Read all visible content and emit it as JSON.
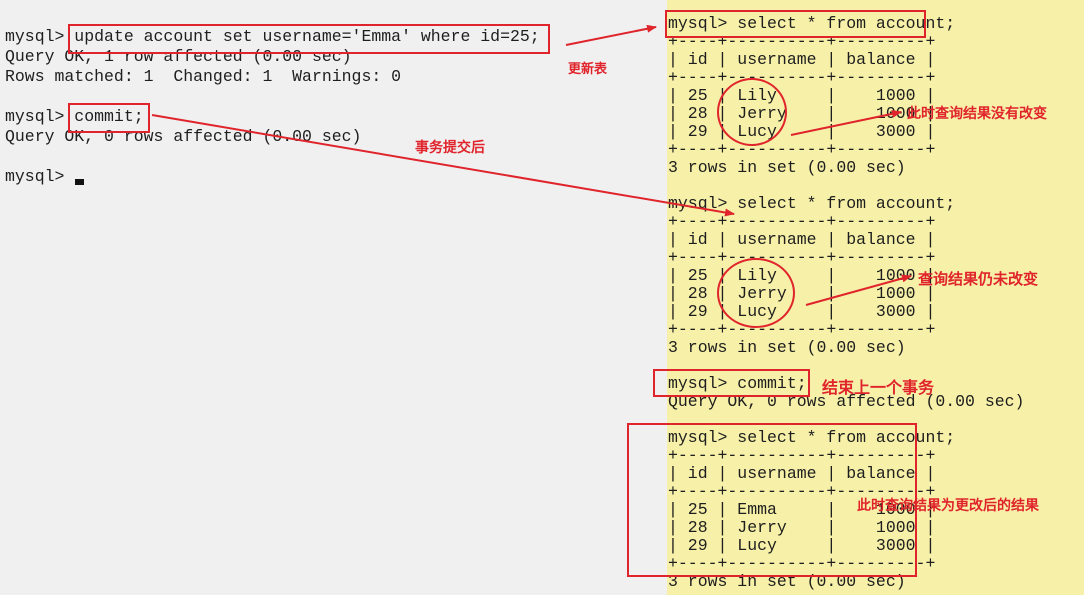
{
  "colors": {
    "left_bg": "#f0f0f0",
    "right_bg": "#f7f0a8",
    "annotation": "#e0242b",
    "text": "#1e1e1e"
  },
  "left_terminal": {
    "lines": [
      "mysql> update account set username='Emma' where id=25;",
      "Query OK, 1 row affected (0.00 sec)",
      "Rows matched: 1  Changed: 1  Warnings: 0",
      "",
      "mysql> commit;",
      "Query OK, 0 rows affected (0.00 sec)",
      "",
      "mysql> "
    ]
  },
  "right_terminal": {
    "lines": [
      "mysql> select * from account;",
      "+----+----------+---------+",
      "| id | username | balance |",
      "+----+----------+---------+",
      "| 25 | Lily     |    1000 |",
      "| 28 | Jerry    |    1000 |",
      "| 29 | Lucy     |    3000 |",
      "+----+----------+---------+",
      "3 rows in set (0.00 sec)",
      "",
      "mysql> select * from account;",
      "+----+----------+---------+",
      "| id | username | balance |",
      "+----+----------+---------+",
      "| 25 | Lily     |    1000 |",
      "| 28 | Jerry    |    1000 |",
      "| 29 | Lucy     |    3000 |",
      "+----+----------+---------+",
      "3 rows in set (0.00 sec)",
      "",
      "mysql> commit;",
      "Query OK, 0 rows affected (0.00 sec)",
      "",
      "mysql> select * from account;",
      "+----+----------+---------+",
      "| id | username | balance |",
      "+----+----------+---------+",
      "| 25 | Emma     |    1000 |",
      "| 28 | Jerry    |    1000 |",
      "| 29 | Lucy     |    3000 |",
      "+----+----------+---------+",
      "3 rows in set (0.00 sec)"
    ]
  },
  "annotations": {
    "update_table": "更新表",
    "after_commit": "事务提交后",
    "result_unchanged_1": "此时查询结果没有改变",
    "result_unchanged_2": "查询结果仍未改变",
    "end_transaction": "结束上一个事务",
    "result_changed": "此时查询结果为更改后的结果"
  }
}
